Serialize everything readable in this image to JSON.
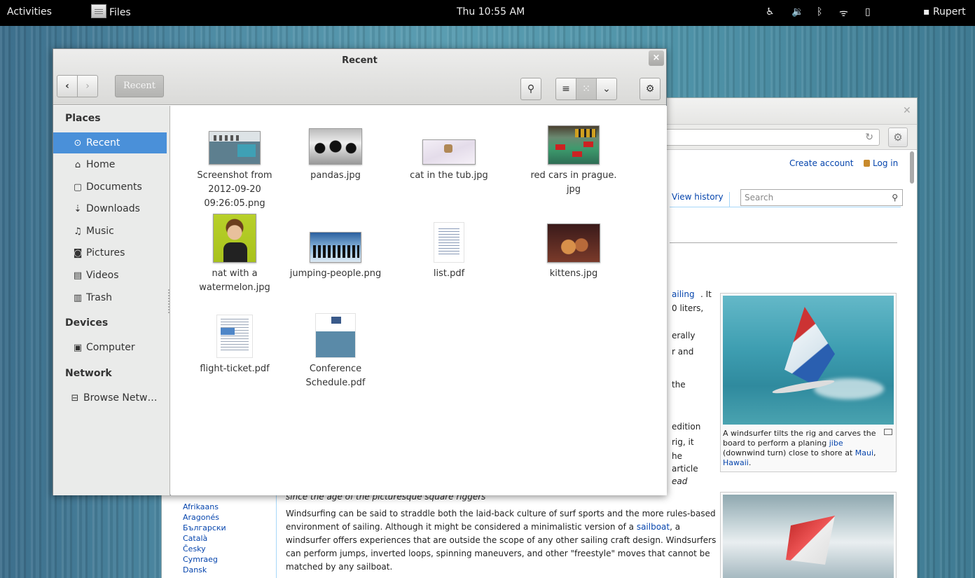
{
  "topbar": {
    "activities": "Activities",
    "app_name": "Files",
    "clock": "Thu 10:55 AM",
    "user": "Rupert",
    "status_icons": [
      "accessibility-icon",
      "volume-icon",
      "bluetooth-icon",
      "wifi-icon",
      "battery-icon",
      "chat-icon"
    ]
  },
  "files": {
    "title": "Recent",
    "toolbar": {
      "back": "‹",
      "forward": "›",
      "breadcrumb": "Recent"
    },
    "sidebar": {
      "places_heading": "Places",
      "devices_heading": "Devices",
      "network_heading": "Network",
      "places": [
        {
          "label": "Recent",
          "icon": "clock-icon",
          "glyph": "⊙"
        },
        {
          "label": "Home",
          "icon": "home-icon",
          "glyph": "⌂"
        },
        {
          "label": "Documents",
          "icon": "document-icon",
          "glyph": "▢"
        },
        {
          "label": "Downloads",
          "icon": "download-icon",
          "glyph": "⇣"
        },
        {
          "label": "Music",
          "icon": "music-icon",
          "glyph": "♫"
        },
        {
          "label": "Pictures",
          "icon": "camera-icon",
          "glyph": "◙"
        },
        {
          "label": "Videos",
          "icon": "film-icon",
          "glyph": "▤"
        },
        {
          "label": "Trash",
          "icon": "trash-icon",
          "glyph": "▥"
        }
      ],
      "devices": [
        {
          "label": "Computer",
          "icon": "computer-icon",
          "glyph": "▣"
        }
      ],
      "network": [
        {
          "label": "Browse Netw…",
          "icon": "network-icon",
          "glyph": "⊟"
        }
      ]
    },
    "items": [
      {
        "name": "Screenshot from 2012-09-20 09:26:05.png",
        "line1": "Screenshot from",
        "line2": "2012-09-20",
        "line3": "09:26:05.png"
      },
      {
        "name": "pandas.jpg",
        "line1": "pandas.jpg",
        "line2": "",
        "line3": ""
      },
      {
        "name": "cat in the tub.jpg",
        "line1": "cat in the tub.jpg",
        "line2": "",
        "line3": ""
      },
      {
        "name": "red cars in prague.jpg",
        "line1": "red cars in prague.",
        "line2": "jpg",
        "line3": ""
      },
      {
        "name": "nat with a watermelon.jpg",
        "line1": "nat with a",
        "line2": "watermelon.jpg",
        "line3": ""
      },
      {
        "name": "jumping-people.png",
        "line1": "jumping-people.png",
        "line2": "",
        "line3": ""
      },
      {
        "name": "list.pdf",
        "line1": "list.pdf",
        "line2": "",
        "line3": ""
      },
      {
        "name": "kittens.jpg",
        "line1": "kittens.jpg",
        "line2": "",
        "line3": ""
      },
      {
        "name": "flight-ticket.pdf",
        "line1": "flight-ticket.pdf",
        "line2": "",
        "line3": ""
      },
      {
        "name": "Conference Schedule.pdf",
        "line1": "Conference",
        "line2": "Schedule.pdf",
        "line3": ""
      }
    ]
  },
  "browser": {
    "create_account": "Create account",
    "log_in": "Log in",
    "view_history": "View history",
    "search_placeholder": "Search",
    "fragments": [
      "ailing",
      ". It",
      "0 liters,",
      "erally",
      "r and",
      "the",
      "edition",
      "rig, it",
      "he",
      "article",
      "ead"
    ],
    "caption_prefix": "A windsurfer tilts the rig and carves the board to perform a planing ",
    "caption_link1": "jibe",
    "caption_mid": " (downwind turn) close to shore at ",
    "caption_link2": "Maui",
    "caption_sep": ", ",
    "caption_link3": "Hawaii",
    "caption_end": ".",
    "italic_line": "since the age of the picturesque square riggers",
    "languages": [
      "Afrikaans",
      "Aragonés",
      "Български",
      "Català",
      "Česky",
      "Cymraeg",
      "Dansk"
    ],
    "article_p1": "Windsurfing can be said to straddle both the laid-back culture of surf sports and the more rules-based environment of sailing. Although it might be considered a minimalistic version of a ",
    "article_link": "sailboat",
    "article_p2": ", a windsurfer offers experiences that are outside the scope of any other sailing craft design. Windsurfers can perform jumps, inverted loops, spinning maneuvers, and other \"freestyle\" moves that cannot be matched by any sailboat."
  }
}
